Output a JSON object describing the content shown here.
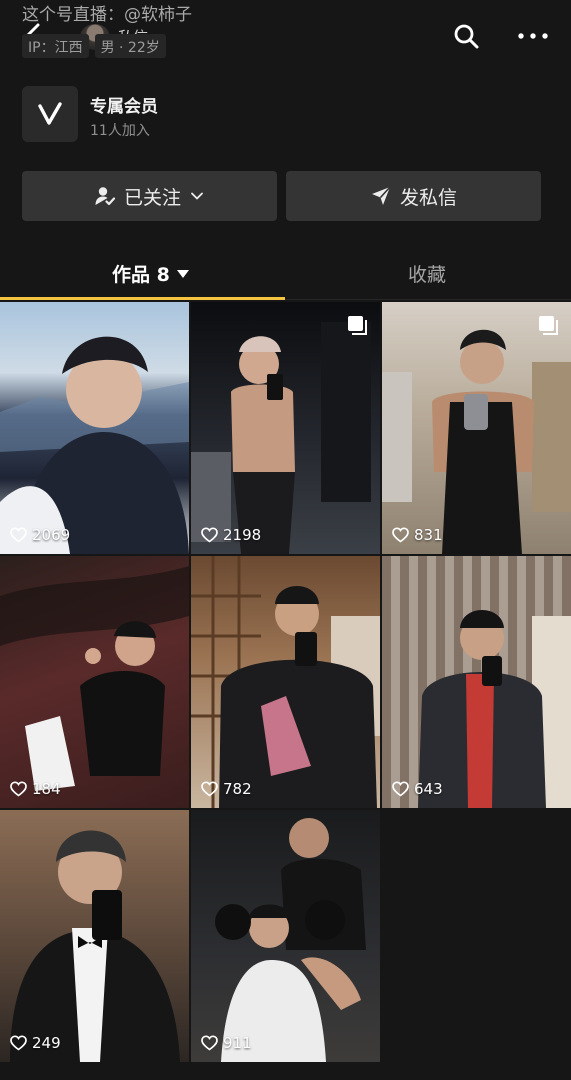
{
  "header": {
    "live_prefix": "这个号直播：",
    "live_name": "@软柿子",
    "dm_label": "私信",
    "ip": "IP：江西",
    "gender_age": "男 · 22岁"
  },
  "member": {
    "title": "专属会员",
    "subtitle": "11人加入"
  },
  "actions": {
    "follow_label": "已关注",
    "dm_label": "发私信"
  },
  "tabs": {
    "works_label": "作品 8",
    "favorites_label": "收藏"
  },
  "colors": {
    "accent": "#f5c542",
    "background": "#161616",
    "button": "#343434"
  },
  "posts": [
    {
      "likes": "2069",
      "multi": false
    },
    {
      "likes": "2198",
      "multi": true
    },
    {
      "likes": "831",
      "multi": true
    },
    {
      "likes": "184",
      "multi": false
    },
    {
      "likes": "782",
      "multi": false
    },
    {
      "likes": "643",
      "multi": false
    },
    {
      "likes": "249",
      "multi": false
    },
    {
      "likes": "911",
      "multi": false
    }
  ]
}
